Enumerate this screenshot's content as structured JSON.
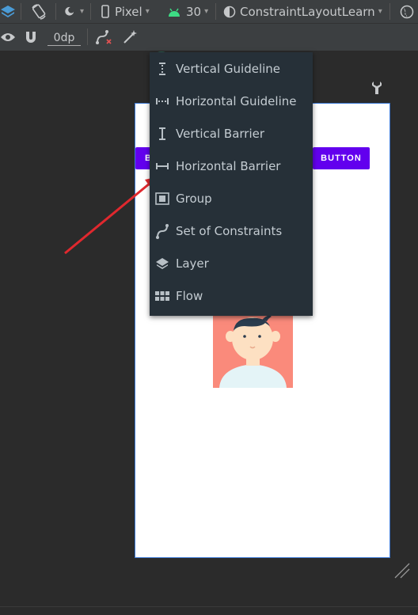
{
  "toolbar": {
    "device": "Pixel",
    "api_level": "30",
    "theme": "ConstraintLayoutLearn",
    "margin_value": "0dp"
  },
  "menu": {
    "items": [
      {
        "label": "Vertical Guideline",
        "icon": "vertical-guideline-icon"
      },
      {
        "label": "Horizontal Guideline",
        "icon": "horizontal-guideline-icon"
      },
      {
        "label": "Vertical Barrier",
        "icon": "vertical-barrier-icon"
      },
      {
        "label": "Horizontal Barrier",
        "icon": "horizontal-barrier-icon"
      },
      {
        "label": "Group",
        "icon": "group-icon"
      },
      {
        "label": "Set of Constraints",
        "icon": "constraints-icon"
      },
      {
        "label": "Layer",
        "icon": "layer-icon"
      },
      {
        "label": "Flow",
        "icon": "flow-icon"
      }
    ]
  },
  "canvas": {
    "button_left_label": "B",
    "button_right_label": "BUTTON"
  },
  "colors": {
    "accent_button": "#6200ee",
    "annotation_arrow": "#e0282e",
    "guideline_button": "#2e6155"
  }
}
